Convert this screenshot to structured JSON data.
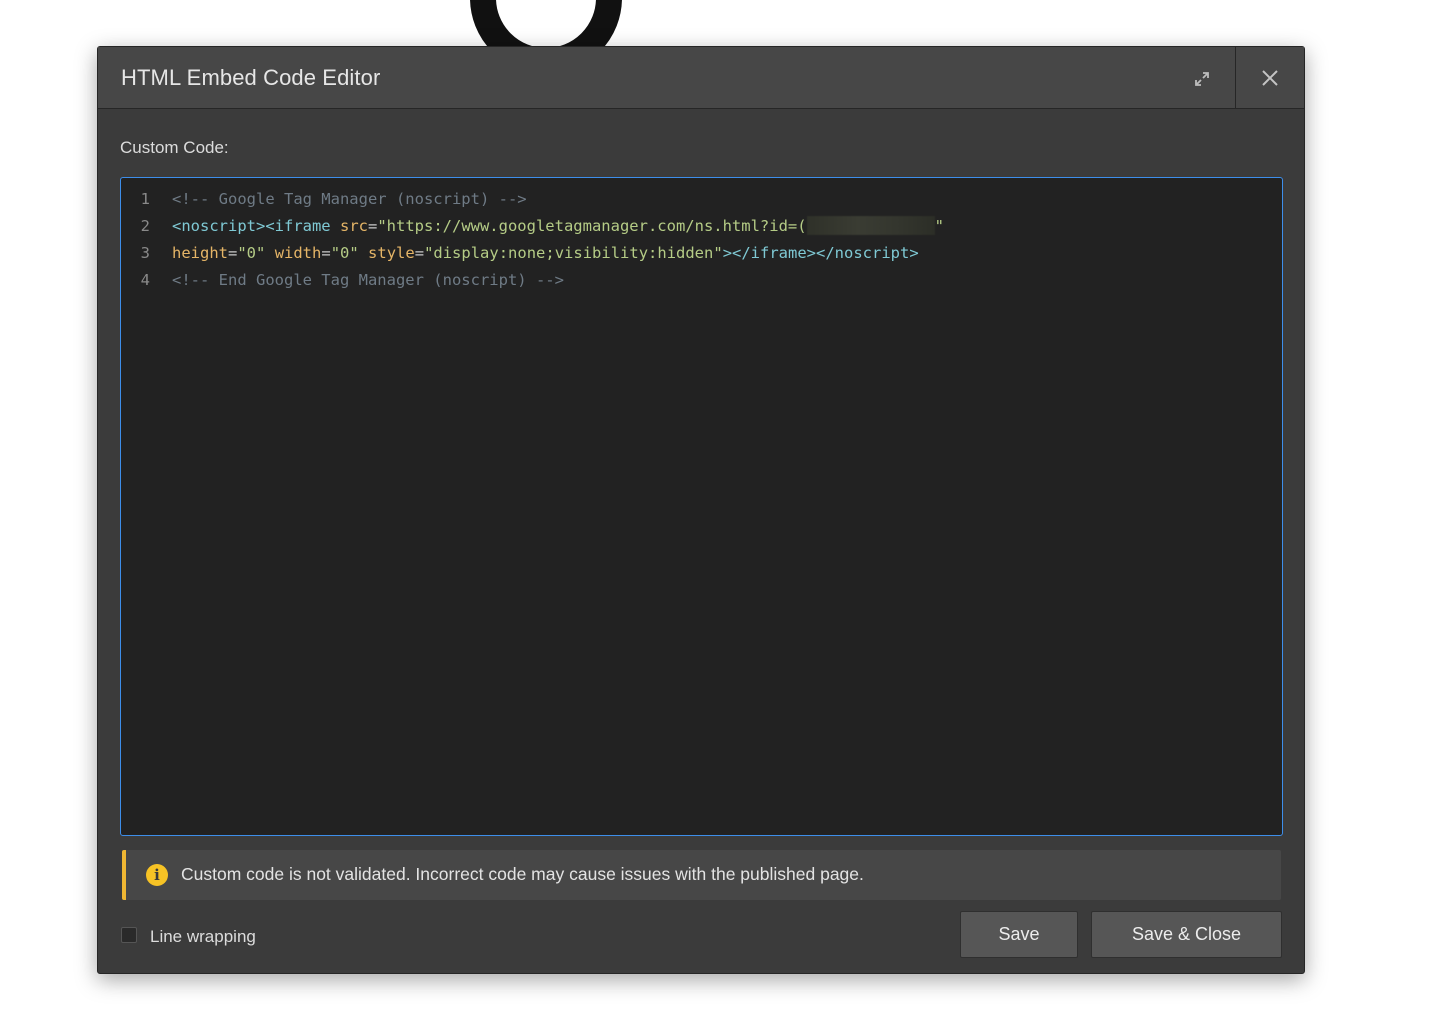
{
  "dialog": {
    "title": "HTML Embed Code Editor",
    "expand_icon": "expand-icon",
    "close_icon": "close-icon"
  },
  "editor": {
    "label": "Custom Code:",
    "lines": [
      {
        "number": "1",
        "comment": "<!-- Google Tag Manager (noscript) -->"
      },
      {
        "number": "2",
        "tag_open": "<noscript><iframe ",
        "attr_src": "src",
        "eq": "=",
        "src_value": "\"https://www.googletagmanager.com/ns.html?id=(",
        "src_end": "\""
      },
      {
        "number": "3",
        "attr_height": "height",
        "height_value": "\"0\"",
        "attr_width": "width",
        "width_value": "\"0\"",
        "attr_style": "style",
        "style_value": "\"display:none;visibility:hidden\"",
        "tag_close": "></iframe></noscript>"
      },
      {
        "number": "4",
        "comment": "<!-- End Google Tag Manager (noscript) -->"
      }
    ]
  },
  "warning": {
    "icon": "info-icon",
    "text": "Custom code is not validated. Incorrect code may cause issues with the published page."
  },
  "footer": {
    "line_wrapping_label": "Line wrapping",
    "line_wrapping_checked": false,
    "save_label": "Save",
    "save_close_label": "Save & Close"
  },
  "colors": {
    "accent": "#3d8eea",
    "warning": "#f0b733",
    "tag": "#7fc9d4",
    "attr": "#e5b567",
    "string": "#b5cc86",
    "comment": "#6f7b86"
  }
}
